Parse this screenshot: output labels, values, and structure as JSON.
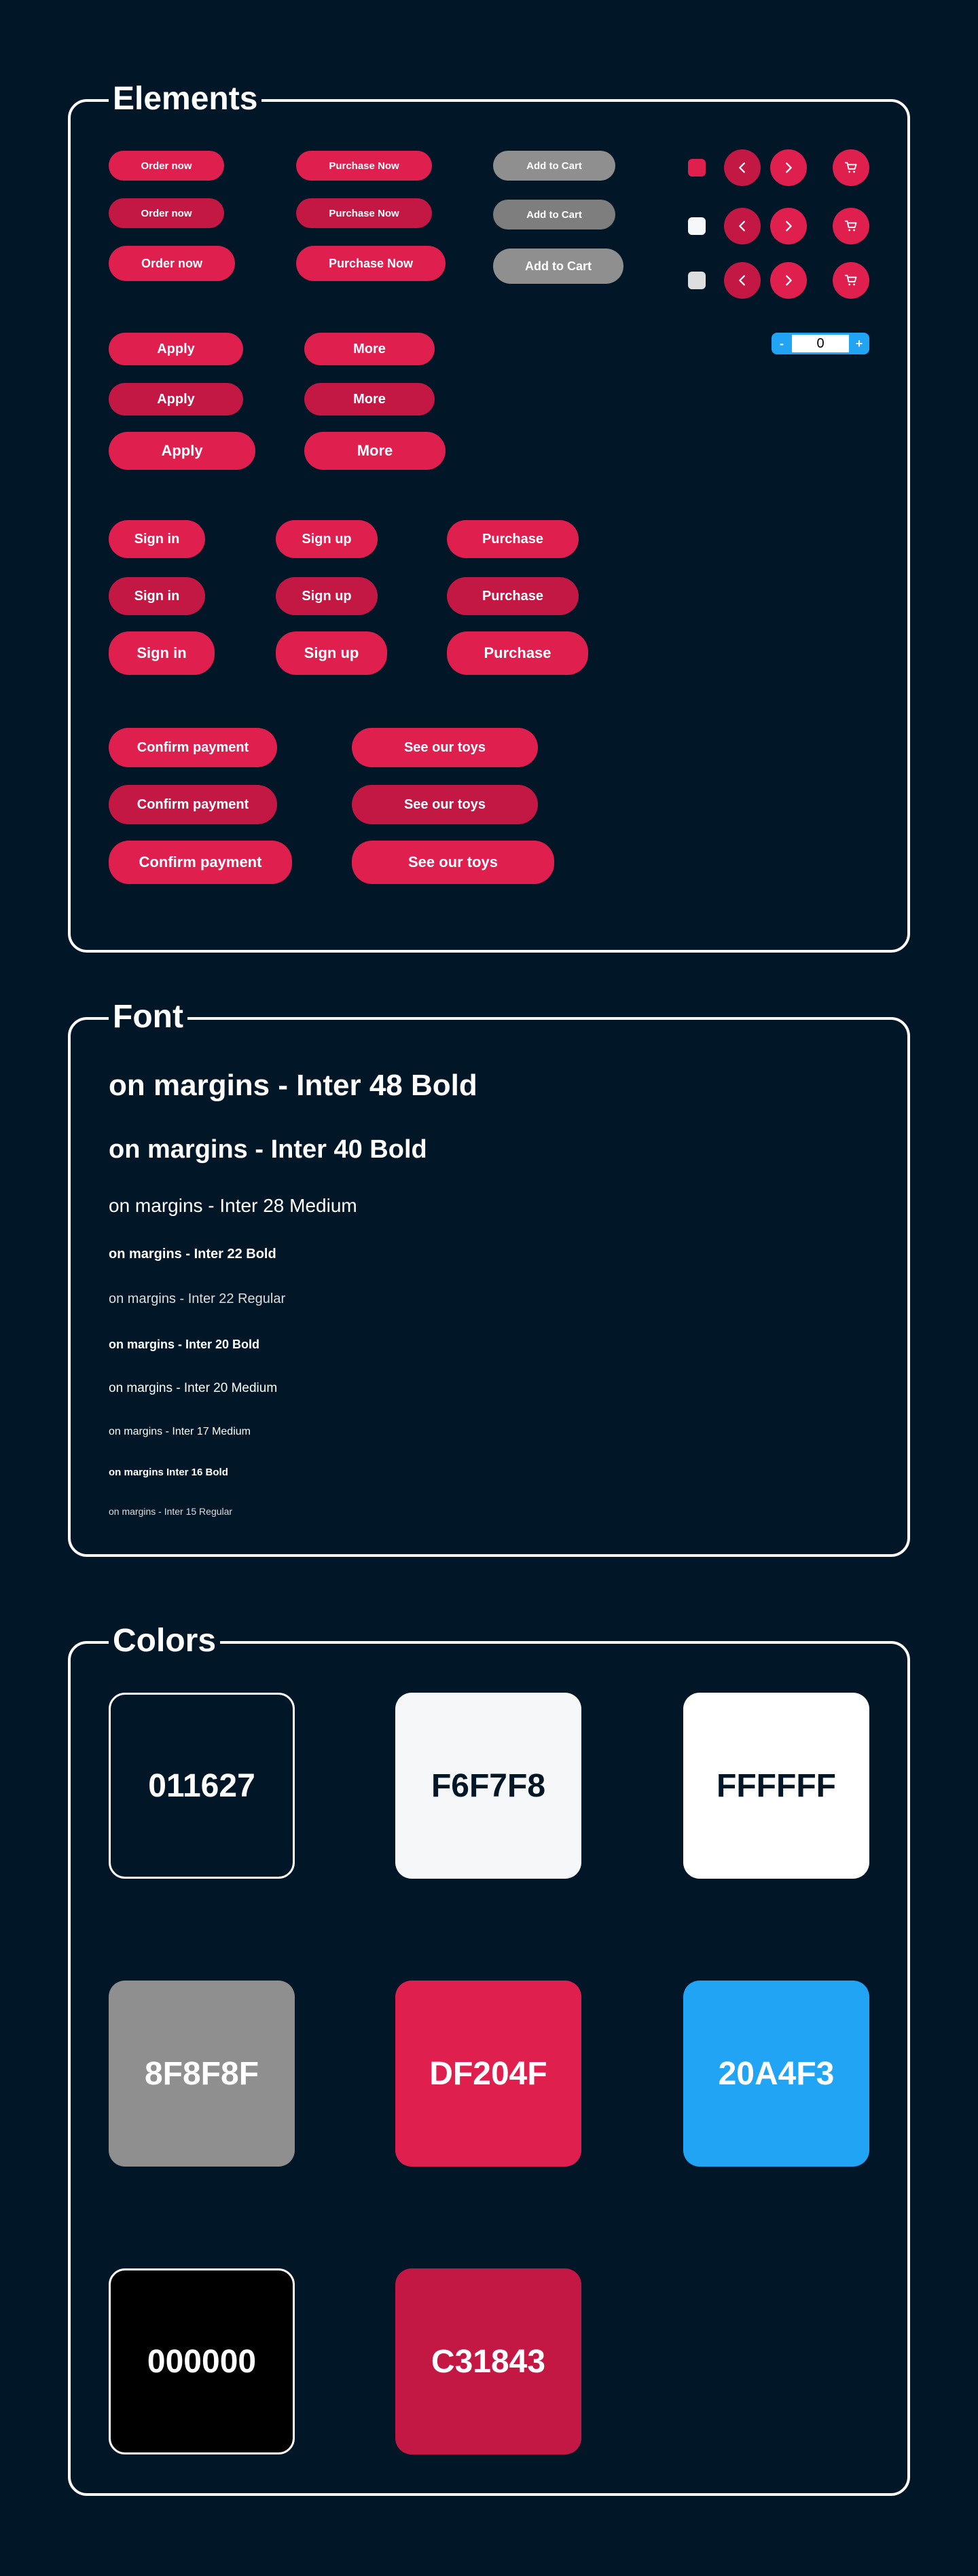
{
  "elements": {
    "title": "Elements",
    "order_now": "Order now",
    "purchase_now": "Purchase Now",
    "add_to_cart": "Add to Cart",
    "apply": "Apply",
    "more": "More",
    "sign_in": "Sign in",
    "sign_up": "Sign up",
    "purchase": "Purchase",
    "confirm_payment": "Confirm payment",
    "see_our_toys": "See our toys",
    "stepper": {
      "minus": "-",
      "value": "0",
      "plus": "+"
    }
  },
  "font": {
    "title": "Font",
    "samples": [
      "on margins - Inter 48 Bold",
      "on margins - Inter 40 Bold",
      "on margins - Inter 28 Medium",
      "on margins - Inter 22 Bold",
      "on margins - Inter 22 Regular",
      "on margins - Inter 20 Bold",
      "on margins - Inter 20 Medium",
      "on margins - Inter 17 Medium",
      "on margins Inter 16 Bold",
      "on margins - Inter 15 Regular"
    ]
  },
  "colors": {
    "title": "Colors",
    "swatches": [
      {
        "hex": "011627"
      },
      {
        "hex": "F6F7F8"
      },
      {
        "hex": "FFFFFF"
      },
      {
        "hex": "8F8F8F"
      },
      {
        "hex": "DF204F"
      },
      {
        "hex": "20A4F3"
      },
      {
        "hex": "000000"
      },
      {
        "hex": "C31843"
      }
    ]
  }
}
